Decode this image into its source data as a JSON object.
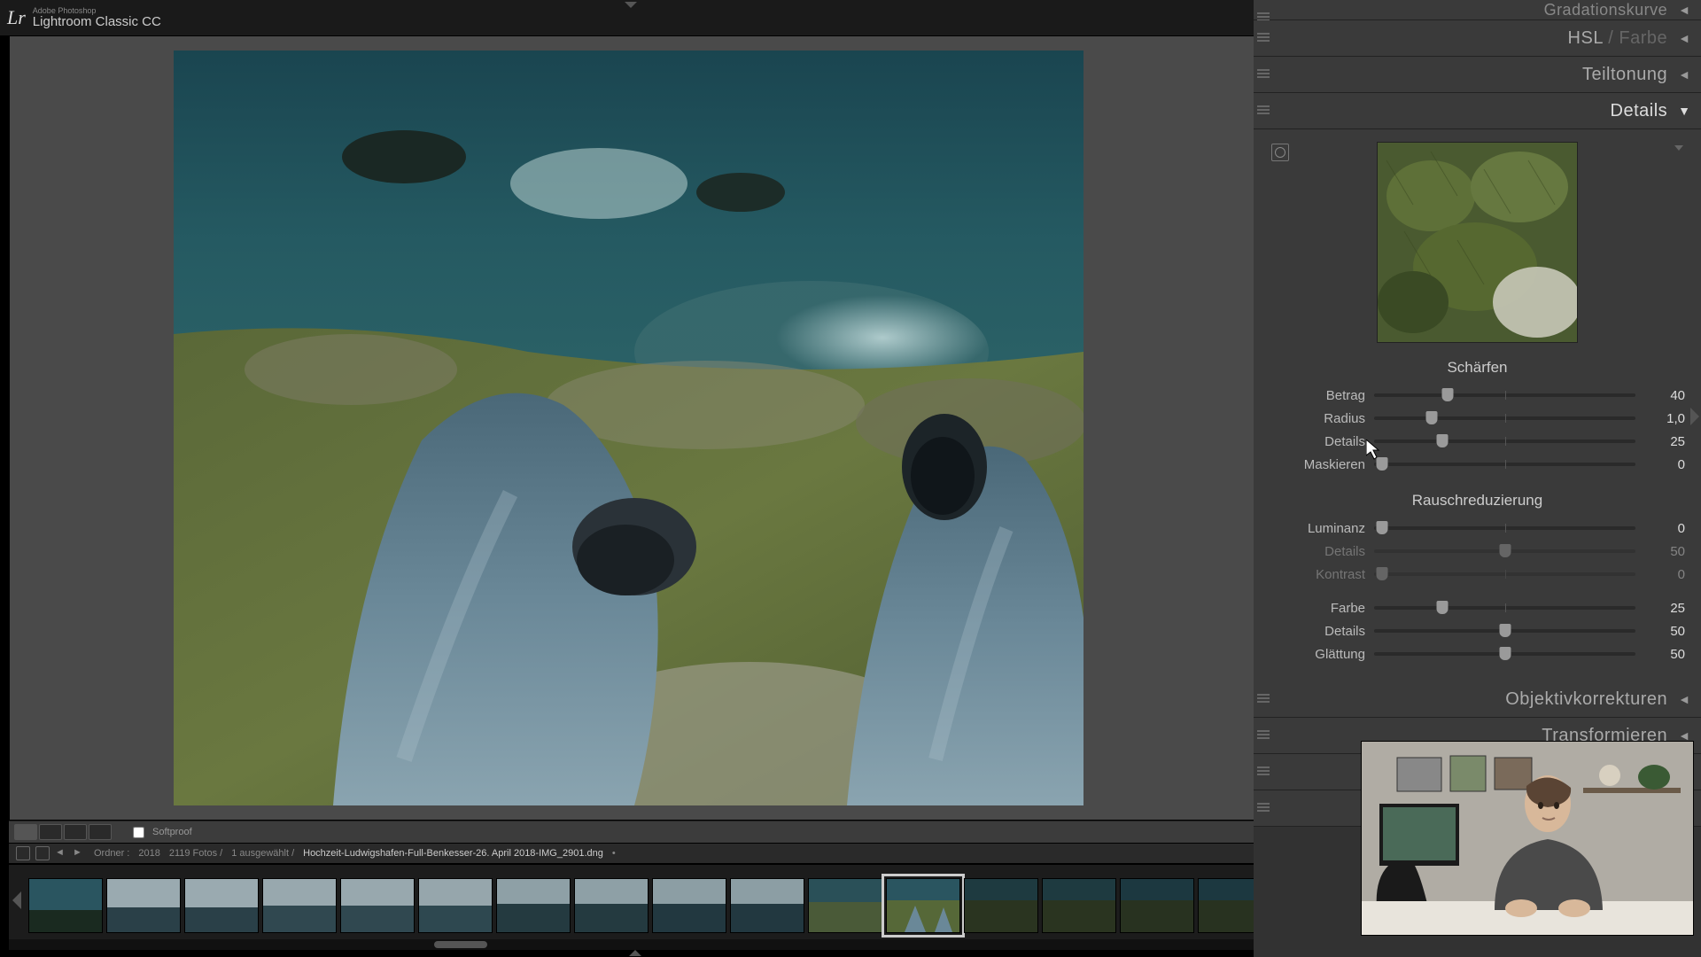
{
  "app": {
    "subtitle": "Adobe Photoshop",
    "name": "Lightroom Classic CC",
    "logo": "Lr"
  },
  "viewbar": {
    "softproof": "Softproof"
  },
  "striphdr": {
    "folder_label": "Ordner :",
    "year": "2018",
    "count": "2119 Fotos /",
    "selected": "1 ausgewählt /",
    "filename": "Hochzeit-Ludwigshafen-Full-Benkesser-26. April 2018-IMG_2901.dng",
    "modified": "•"
  },
  "panels": {
    "curve": "Gradationskurve",
    "hsl": "HSL",
    "hsl_dim": " / Farbe",
    "split": "Teiltonung",
    "details": "Details",
    "lens": "Objektivkorrekturen",
    "transform": "Transformieren"
  },
  "details": {
    "sharpen_title": "Schärfen",
    "amount_label": "Betrag",
    "amount_val": "40",
    "radius_label": "Radius",
    "radius_val": "1,0",
    "detail_label": "Details",
    "detail_val": "25",
    "mask_label": "Maskieren",
    "mask_val": "0",
    "nr_title": "Rauschreduzierung",
    "lum_label": "Luminanz",
    "lum_val": "0",
    "lum_detail_label": "Details",
    "lum_detail_val": "50",
    "lum_contrast_label": "Kontrast",
    "lum_contrast_val": "0",
    "color_label": "Farbe",
    "color_val": "25",
    "color_detail_label": "Details",
    "color_detail_val": "50",
    "smooth_label": "Glättung",
    "smooth_val": "50"
  }
}
